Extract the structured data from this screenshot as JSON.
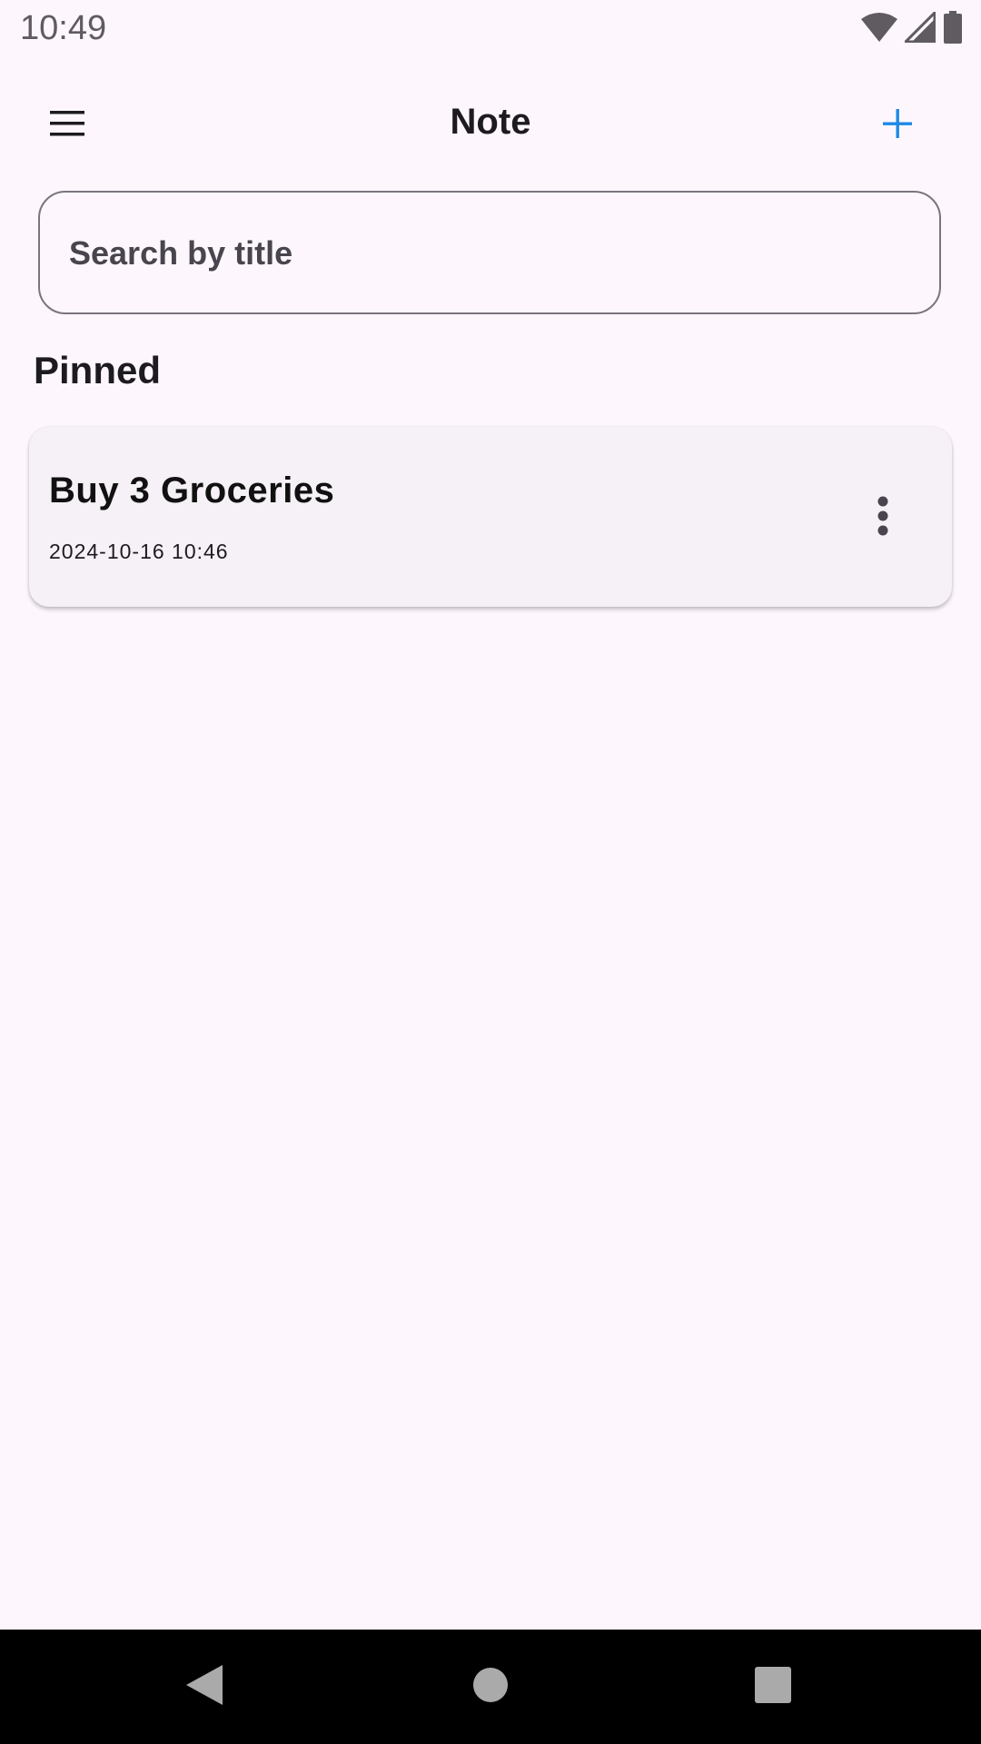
{
  "status_bar": {
    "time": "10:49",
    "icons": [
      "wifi-icon",
      "cellular-signal-icon",
      "battery-icon"
    ]
  },
  "app_bar": {
    "title": "Note",
    "menu_icon": "hamburger-menu-icon",
    "add_icon": "plus-icon",
    "accent_color": "#1e88e5"
  },
  "search": {
    "placeholder": "Search by title",
    "value": ""
  },
  "sections": {
    "pinned": {
      "heading": "Pinned",
      "notes": [
        {
          "title": "Buy 3 Groceries",
          "date": "2024-10-16 10:46",
          "menu_icon": "more-vert-icon"
        }
      ]
    }
  },
  "nav_bar": {
    "icons": [
      "back-icon",
      "home-icon",
      "recents-icon"
    ]
  },
  "colors": {
    "background": "#fdf7fd",
    "card": "#f6f1f6",
    "text": "#1d1b20"
  }
}
